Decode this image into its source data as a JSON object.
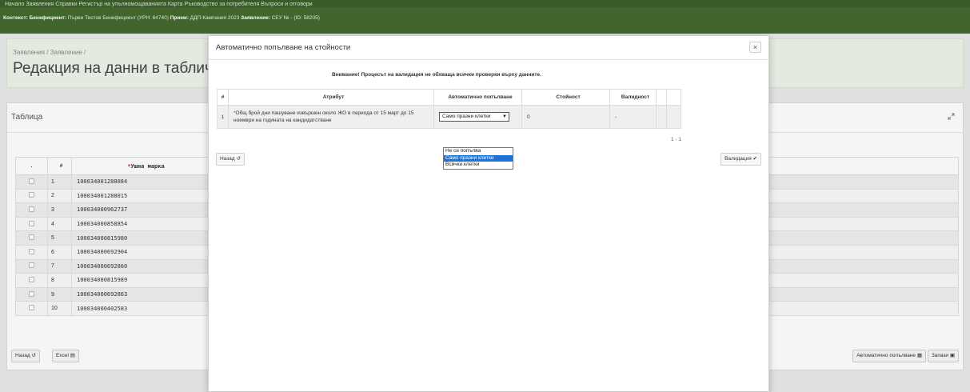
{
  "nav": {
    "text": "Начало    Заявления    Справки    Регистър на упълномощаванията    Карта    Ръководство за потребителя    Въпроси и отговори"
  },
  "context": {
    "label": "Контекст:",
    "beneficiary_label": "Бенефициент:",
    "beneficiary_value": "Първи Тестов Бенефициент (УРН: 64740)",
    "intake_label": "Прием:",
    "intake_value": "ДДП-Кампания 2023",
    "application_label": "Заявление:",
    "application_value": "СЕУ № - (ID: 58205)"
  },
  "header": {
    "breadcrumb": "Заявления / Заявление /",
    "title": "Редакция на данни в таблична форма"
  },
  "panel": {
    "title": "Таблица",
    "expand_icon": "expand-icon",
    "columns": [
      ".",
      "#",
      "Ушна марка"
    ],
    "required_mark": "*",
    "rows": [
      {
        "n": "1",
        "ear": "100034001288084"
      },
      {
        "n": "2",
        "ear": "100034001288015"
      },
      {
        "n": "3",
        "ear": "100034000962737"
      },
      {
        "n": "4",
        "ear": "100034000858854"
      },
      {
        "n": "5",
        "ear": "100034000815980"
      },
      {
        "n": "6",
        "ear": "100034000692904"
      },
      {
        "n": "7",
        "ear": "100034000692860"
      },
      {
        "n": "8",
        "ear": "100034000815989"
      },
      {
        "n": "9",
        "ear": "100034000692863"
      },
      {
        "n": "10",
        "ear": "100034000402583"
      }
    ],
    "back_label": "Назад",
    "excel_label": "Excel",
    "autofill_label": "Автоматично попълване",
    "save_label": "Запази"
  },
  "modal": {
    "title": "Автоматично попълване на стойности",
    "close": "×",
    "warning": "Внимание! Процесът на валидация не обхваща всички проверки върху данните.",
    "columns": {
      "n": "#",
      "attr": "Атрибут",
      "auto": "Автоматично попълване",
      "value": "Стойност",
      "validity": "Валидност"
    },
    "row": {
      "n": "1",
      "required_mark": "*",
      "attr": "Общ брой дни пашуване извършен около ЖО в периода от 15 март до 15 ноември на годината на кандидатстване",
      "auto_selected": "Само празни клетки",
      "value": "0",
      "validity": "-"
    },
    "dropdown_options": [
      "Не се попълва",
      "Само празни клетки",
      "Всички клетки"
    ],
    "dropdown_selected_index": 1,
    "pager": "1 - 1",
    "back_label": "Назад",
    "validate_label": "Валидация"
  },
  "colors": {
    "nav_green": "#3b5f29",
    "context_green": "#446b2f",
    "header_bg": "#eef4ea",
    "dropdown_selected": "#1e74d6"
  }
}
